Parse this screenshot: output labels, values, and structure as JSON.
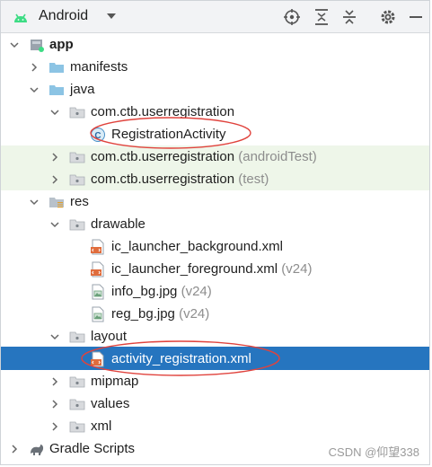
{
  "toolbar": {
    "project_view": "Android"
  },
  "tree": {
    "app": "app",
    "manifests": "manifests",
    "java": "java",
    "pkg_main": "com.ctb.userregistration",
    "registration_activity": "RegistrationActivity",
    "pkg_android_test": "com.ctb.userregistration",
    "pkg_android_test_suffix": "(androidTest)",
    "pkg_test": "com.ctb.userregistration",
    "pkg_test_suffix": "(test)",
    "res": "res",
    "drawable": "drawable",
    "ic_bg": "ic_launcher_background.xml",
    "ic_fg": "ic_launcher_foreground.xml",
    "ic_fg_suffix": "(v24)",
    "info_bg": "info_bg.jpg",
    "info_bg_suffix": "(v24)",
    "reg_bg": "reg_bg.jpg",
    "reg_bg_suffix": "(v24)",
    "layout": "layout",
    "activity_xml": "activity_registration.xml",
    "mipmap": "mipmap",
    "values": "values",
    "xml": "xml",
    "gradle": "Gradle Scripts"
  },
  "watermark": "CSDN @仰望338",
  "colors": {
    "selection": "#2675bf",
    "test_row": "#eef6e9",
    "annotation_oval": "#e0433d",
    "android_green": "#3ddc84"
  }
}
